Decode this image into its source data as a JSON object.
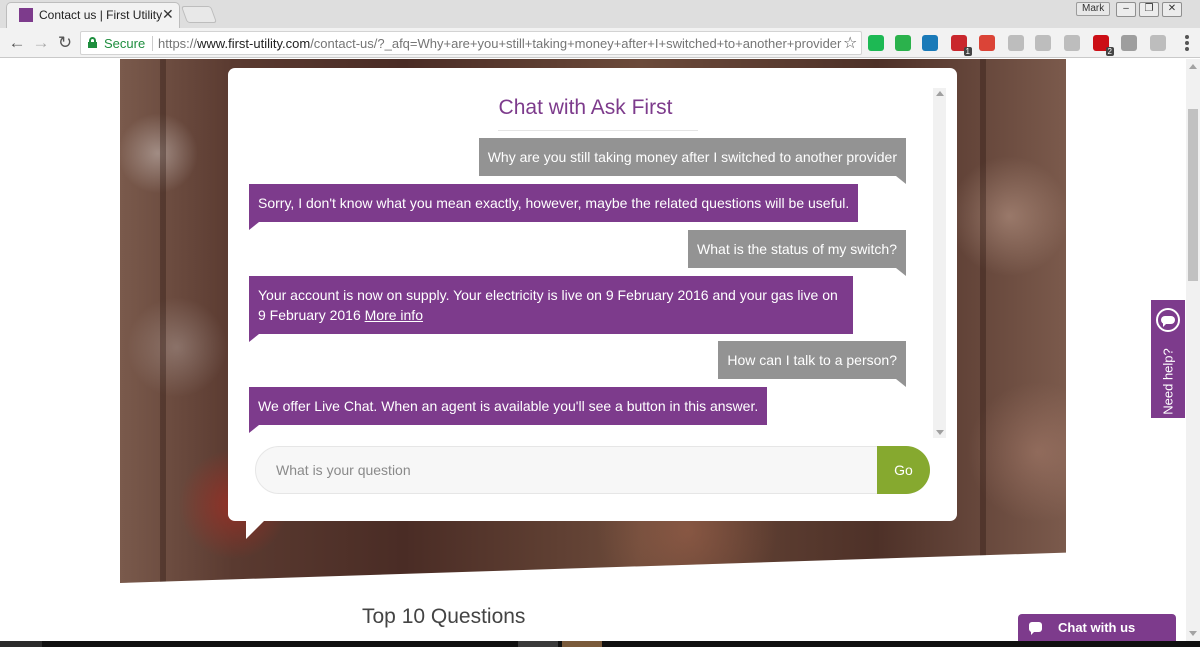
{
  "browser": {
    "tab_title": "Contact us | First Utility",
    "tab_close": "✕",
    "profile_name": "Mark",
    "win_minimize": "–",
    "win_restore": "❐",
    "win_close": "✕",
    "back": "←",
    "forward": "→",
    "reload": "↻",
    "secure_label": "Secure",
    "url_prefix": "https://",
    "url_host": "www.first-utility.com",
    "url_path": "/contact-us/?_afq=Why+are+you+still+taking+money+after+I+switched+to+another+provider",
    "bookmark_star": "☆",
    "extensions": [
      {
        "name": "spotify-icon",
        "color": "#1db954",
        "badge": ""
      },
      {
        "name": "feedly-icon",
        "color": "#2bb24c",
        "badge": ""
      },
      {
        "name": "vimeo-icon",
        "color": "#1a7ab8",
        "badge": ""
      },
      {
        "name": "pdf-icon",
        "color": "#c9272d",
        "badge": "1"
      },
      {
        "name": "google-icon",
        "color": "#db4437",
        "badge": ""
      },
      {
        "name": "skype-icon",
        "color": "#bdbdbd",
        "badge": ""
      },
      {
        "name": "keyboard-icon",
        "color": "#bdbdbd",
        "badge": ""
      },
      {
        "name": "font-icon",
        "color": "#bdbdbd",
        "badge": ""
      },
      {
        "name": "opera-icon",
        "color": "#cc0f16",
        "badge": "2"
      },
      {
        "name": "camera-icon",
        "color": "#9e9e9e",
        "badge": ""
      },
      {
        "name": "plus-icon",
        "color": "#bdbdbd",
        "badge": ""
      }
    ]
  },
  "chat": {
    "title": "Chat with Ask First",
    "messages": [
      {
        "role": "user",
        "text": "Why are you still taking money after I switched to another provider"
      },
      {
        "role": "bot",
        "text": "Sorry, I don't know what you mean exactly, however, maybe the related questions will be useful."
      },
      {
        "role": "user",
        "text": "What is the status of my switch?"
      },
      {
        "role": "bot",
        "text": "Your account is now on supply. Your electricity is live on 9 February 2016 and your gas live on 9 February 2016",
        "link": "More info"
      },
      {
        "role": "user",
        "text": "How can I talk to a person?"
      },
      {
        "role": "bot",
        "text": "We offer Live Chat. When an agent is available you'll see a button in this answer."
      }
    ],
    "input_placeholder": "What is your question",
    "input_value": "",
    "go_label": "Go"
  },
  "section_heading": "Top 10 Questions",
  "need_help_label": "Need help?",
  "chat_with_us_label": "Chat with us",
  "colors": {
    "brand_purple": "#7d3b8c",
    "go_green": "#86a92f",
    "user_bubble": "#939393"
  }
}
